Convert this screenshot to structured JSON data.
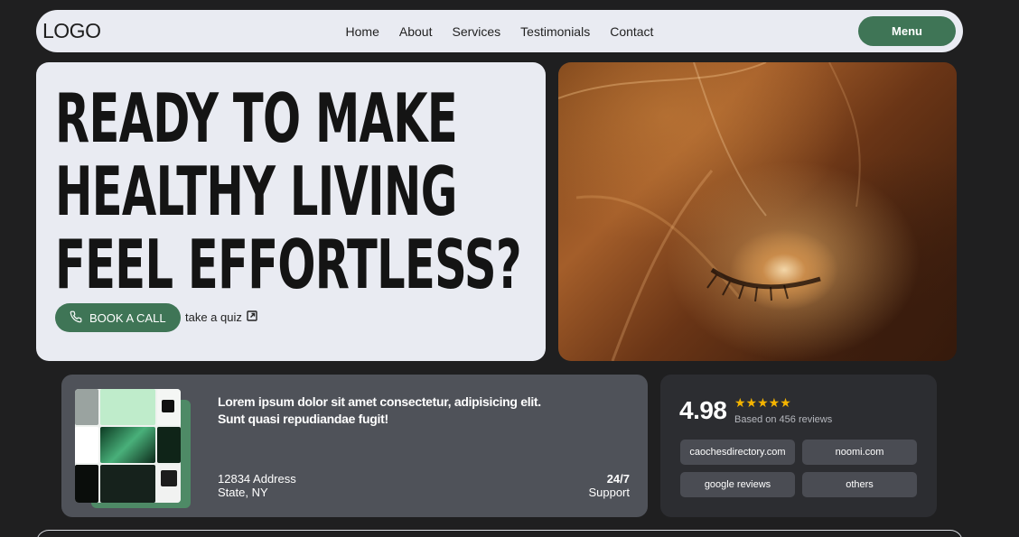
{
  "nav": {
    "logo": "LOGO",
    "links": [
      "Home",
      "About",
      "Services",
      "Testimonials",
      "Contact"
    ],
    "menu_label": "Menu"
  },
  "hero": {
    "title_lines": [
      "READY TO MAKE",
      "HEALTHY LIVING",
      "FEEL EFFORTLESS?"
    ],
    "book_label": "BOOK A CALL",
    "quiz_label": "take a quiz"
  },
  "info": {
    "text_line1": "Lorem ipsum dolor sit amet consectetur, adipisicing elit.",
    "text_line2": "Sunt quasi repudiandae fugit!",
    "address_line1": "12834 Address",
    "address_line2": "State, NY",
    "support_top": "24/7",
    "support_bottom": "Support"
  },
  "reviews": {
    "score": "4.98",
    "stars": "★★★★★",
    "based_on": "Based on 456 reviews",
    "sources": [
      "caochesdirectory.com",
      "noomi.com",
      "google reviews",
      "others"
    ]
  },
  "colors": {
    "accent": "#3f7556",
    "background": "#1f1f20",
    "card_light": "#e9ebf2",
    "star": "#f4b400"
  }
}
